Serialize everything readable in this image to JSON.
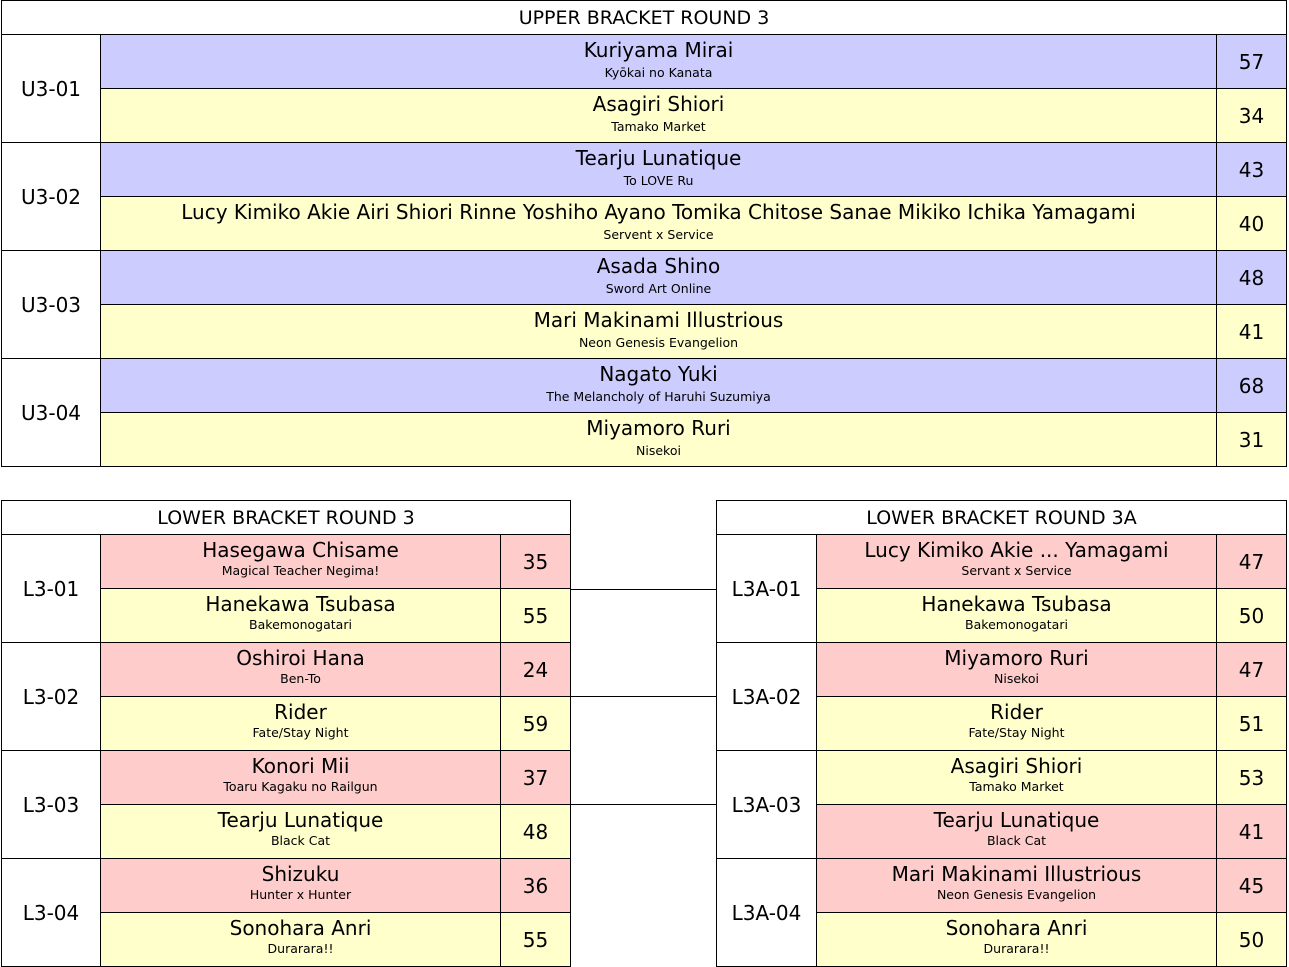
{
  "upper": {
    "title": "UPPER BRACKET ROUND 3",
    "matches": [
      {
        "code": "U3-01",
        "entries": [
          {
            "name": "Kuriyama Mirai",
            "series": "Kyōkai no Kanata",
            "score": "57",
            "color": "#ccccff"
          },
          {
            "name": "Asagiri Shiori",
            "series": "Tamako Market",
            "score": "34",
            "color": "#ffffcc"
          }
        ]
      },
      {
        "code": "U3-02",
        "entries": [
          {
            "name": "Tearju Lunatique",
            "series": "To LOVE Ru",
            "score": "43",
            "color": "#ccccff"
          },
          {
            "name": "Lucy Kimiko Akie Airi Shiori Rinne Yoshiho Ayano Tomika Chitose Sanae Mikiko Ichika Yamagami",
            "series": "Servent x Service",
            "score": "40",
            "color": "#ffffcc"
          }
        ]
      },
      {
        "code": "U3-03",
        "entries": [
          {
            "name": "Asada Shino",
            "series": "Sword Art Online",
            "score": "48",
            "color": "#ccccff"
          },
          {
            "name": "Mari Makinami Illustrious",
            "series": "Neon Genesis Evangelion",
            "score": "41",
            "color": "#ffffcc"
          }
        ]
      },
      {
        "code": "U3-04",
        "entries": [
          {
            "name": "Nagato Yuki",
            "series": "The Melancholy of Haruhi Suzumiya",
            "score": "68",
            "color": "#ccccff"
          },
          {
            "name": "Miyamoro Ruri",
            "series": "Nisekoi",
            "score": "31",
            "color": "#ffffcc"
          }
        ]
      }
    ]
  },
  "lower": {
    "title": "LOWER BRACKET ROUND 3",
    "matches": [
      {
        "code": "L3-01",
        "entries": [
          {
            "name": "Hasegawa Chisame",
            "series": "Magical Teacher Negima!",
            "score": "35",
            "color": "#ffcccc"
          },
          {
            "name": "Hanekawa Tsubasa",
            "series": "Bakemonogatari",
            "score": "55",
            "color": "#ffffcc"
          }
        ]
      },
      {
        "code": "L3-02",
        "entries": [
          {
            "name": "Oshiroi Hana",
            "series": "Ben-To",
            "score": "24",
            "color": "#ffcccc"
          },
          {
            "name": "Rider",
            "series": "Fate/Stay Night",
            "score": "59",
            "color": "#ffffcc"
          }
        ]
      },
      {
        "code": "L3-03",
        "entries": [
          {
            "name": "Konori Mii",
            "series": "Toaru Kagaku no Railgun",
            "score": "37",
            "color": "#ffcccc"
          },
          {
            "name": "Tearju Lunatique",
            "series": "Black Cat",
            "score": "48",
            "color": "#ffffcc"
          }
        ]
      },
      {
        "code": "L3-04",
        "entries": [
          {
            "name": "Shizuku",
            "series": "Hunter x Hunter",
            "score": "36",
            "color": "#ffcccc"
          },
          {
            "name": "Sonohara Anri",
            "series": "Durarara!!",
            "score": "55",
            "color": "#ffffcc"
          }
        ]
      }
    ]
  },
  "lower_a": {
    "title": "LOWER BRACKET ROUND 3A",
    "matches": [
      {
        "code": "L3A-01",
        "entries": [
          {
            "name": "Lucy Kimiko Akie ... Yamagami",
            "series": "Servant x Service",
            "score": "47",
            "color": "#ffcccc"
          },
          {
            "name": "Hanekawa Tsubasa",
            "series": "Bakemonogatari",
            "score": "50",
            "color": "#ffffcc"
          }
        ]
      },
      {
        "code": "L3A-02",
        "entries": [
          {
            "name": "Miyamoro Ruri",
            "series": "Nisekoi",
            "score": "47",
            "color": "#ffcccc"
          },
          {
            "name": "Rider",
            "series": "Fate/Stay Night",
            "score": "51",
            "color": "#ffffcc"
          }
        ]
      },
      {
        "code": "L3A-03",
        "entries": [
          {
            "name": "Asagiri Shiori",
            "series": "Tamako Market",
            "score": "53",
            "color": "#ffffcc"
          },
          {
            "name": "Tearju Lunatique",
            "series": "Black Cat",
            "score": "41",
            "color": "#ffcccc"
          }
        ]
      },
      {
        "code": "L3A-04",
        "entries": [
          {
            "name": "Mari Makinami Illustrious",
            "series": "Neon Genesis Evangelion",
            "score": "45",
            "color": "#ffcccc"
          },
          {
            "name": "Sonohara Anri",
            "series": "Durarara!!",
            "score": "50",
            "color": "#ffffcc"
          }
        ]
      }
    ]
  }
}
